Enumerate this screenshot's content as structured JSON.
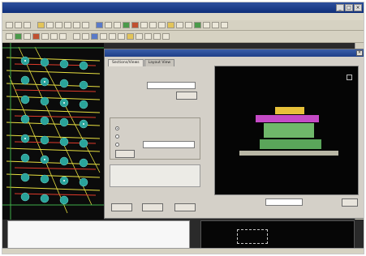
{
  "window": {
    "title": "",
    "controls": [
      "_",
      "□",
      "×"
    ]
  },
  "menu": {
    "items": []
  },
  "dialog": {
    "title": "",
    "close_glyph": "×",
    "tabs": [
      {
        "label": "Sections/Views"
      },
      {
        "label": "Layout View"
      }
    ],
    "fields": {
      "name_label": "",
      "name_value": "",
      "browse_label": "",
      "info_label": ""
    },
    "group": {
      "label": "",
      "options": [
        {
          "label": "",
          "selected": true
        },
        {
          "label": "",
          "selected": false
        },
        {
          "label": "",
          "selected": false
        }
      ],
      "clear_label": ""
    },
    "note": "",
    "buttons": {
      "ok": "",
      "apply": "",
      "cancel": ""
    },
    "preview": {
      "layers": [
        {
          "label": "",
          "color": "#e7c13a"
        },
        {
          "label": "",
          "color": "#c54ac6"
        },
        {
          "label": "",
          "color": "#6fb86a"
        },
        {
          "label": "",
          "color": "#5aa55a"
        },
        {
          "label": "",
          "color": "#b9b7a5"
        }
      ],
      "scale_label": "",
      "scale_value": "",
      "help_label": ""
    }
  },
  "log": {
    "lines": []
  },
  "colors": {
    "canvas_bg": "#0b0b0b",
    "accent_blue": "#1e3e88",
    "trace_yellow": "#e8e040",
    "trace_red": "#e03a2a",
    "via_cyan": "#2aa39a"
  }
}
